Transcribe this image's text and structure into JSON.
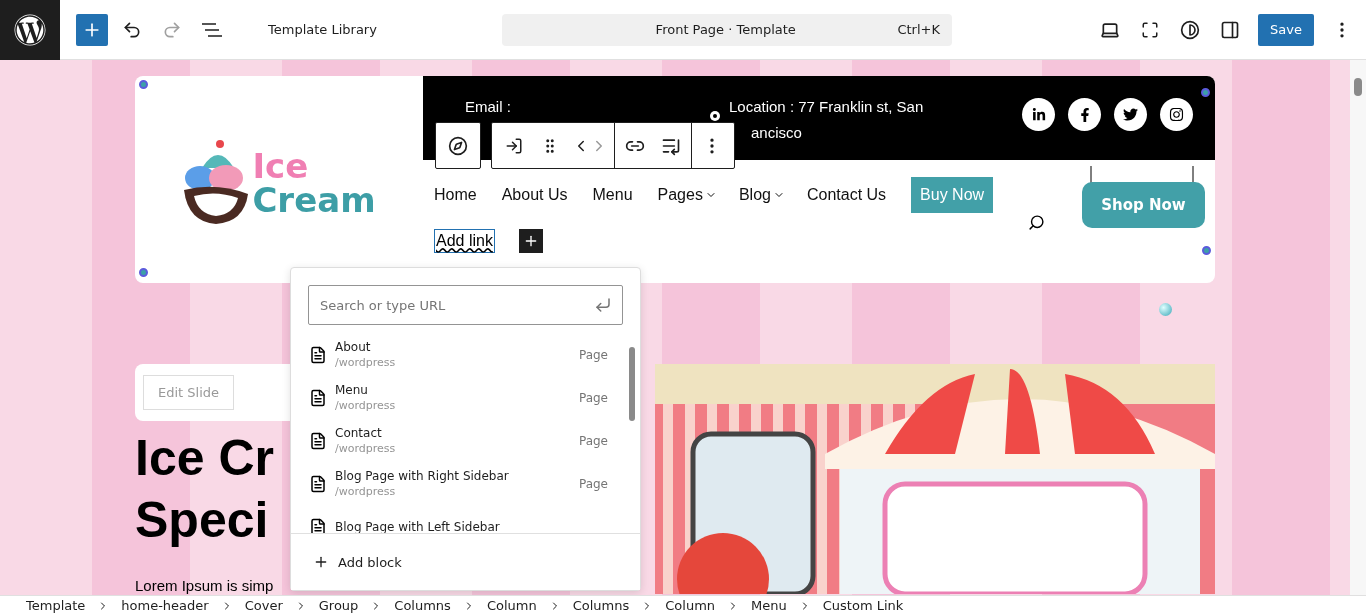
{
  "topbar": {
    "title": "Template Library",
    "command": {
      "label": "Front Page · Template",
      "shortcut": "Ctrl+K"
    },
    "redo": {
      "disabled": true
    },
    "save": "Save"
  },
  "header": {
    "logo": {
      "line1": "Ice",
      "line2": "Cream"
    },
    "email_label": "Email :",
    "location": [
      "Location : 77 Franklin st, San",
      "ancisco"
    ],
    "social": [
      {
        "kind": "linkedin"
      },
      {
        "kind": "facebook"
      },
      {
        "kind": "twitter"
      },
      {
        "kind": "instagram"
      }
    ],
    "nav": [
      {
        "label": "Home",
        "kind": "link"
      },
      {
        "label": "About Us",
        "kind": "link"
      },
      {
        "label": "Menu",
        "kind": "link"
      },
      {
        "label": "Pages",
        "kind": "dropdown"
      },
      {
        "label": "Blog",
        "kind": "dropdown"
      },
      {
        "label": "Contact Us",
        "kind": "link"
      },
      {
        "label": "Buy Now",
        "kind": "button"
      }
    ],
    "add_link": "Add link",
    "shop_button": "Shop Now"
  },
  "link_popover": {
    "placeholder": "Search or type URL",
    "results": [
      {
        "title": "About",
        "url": "/wordpress",
        "type": "Page"
      },
      {
        "title": "Menu",
        "url": "/wordpress",
        "type": "Page"
      },
      {
        "title": "Contact",
        "url": "/wordpress",
        "type": "Page"
      },
      {
        "title": "Blog Page with Right Sidebar",
        "url": "/wordpress",
        "type": "Page"
      },
      {
        "title": "Blog Page with Left Sidebar"
      }
    ],
    "add_block": "Add block"
  },
  "hero": {
    "edit_button": "Edit Slide",
    "heading": [
      "Ice Cr",
      "Speci"
    ],
    "text": "Lorem Ipsum is simp"
  },
  "breadcrumbs": [
    "Template",
    "home-header",
    "Cover",
    "Group",
    "Columns",
    "Column",
    "Columns",
    "Column",
    "Menu",
    "Custom Link"
  ]
}
